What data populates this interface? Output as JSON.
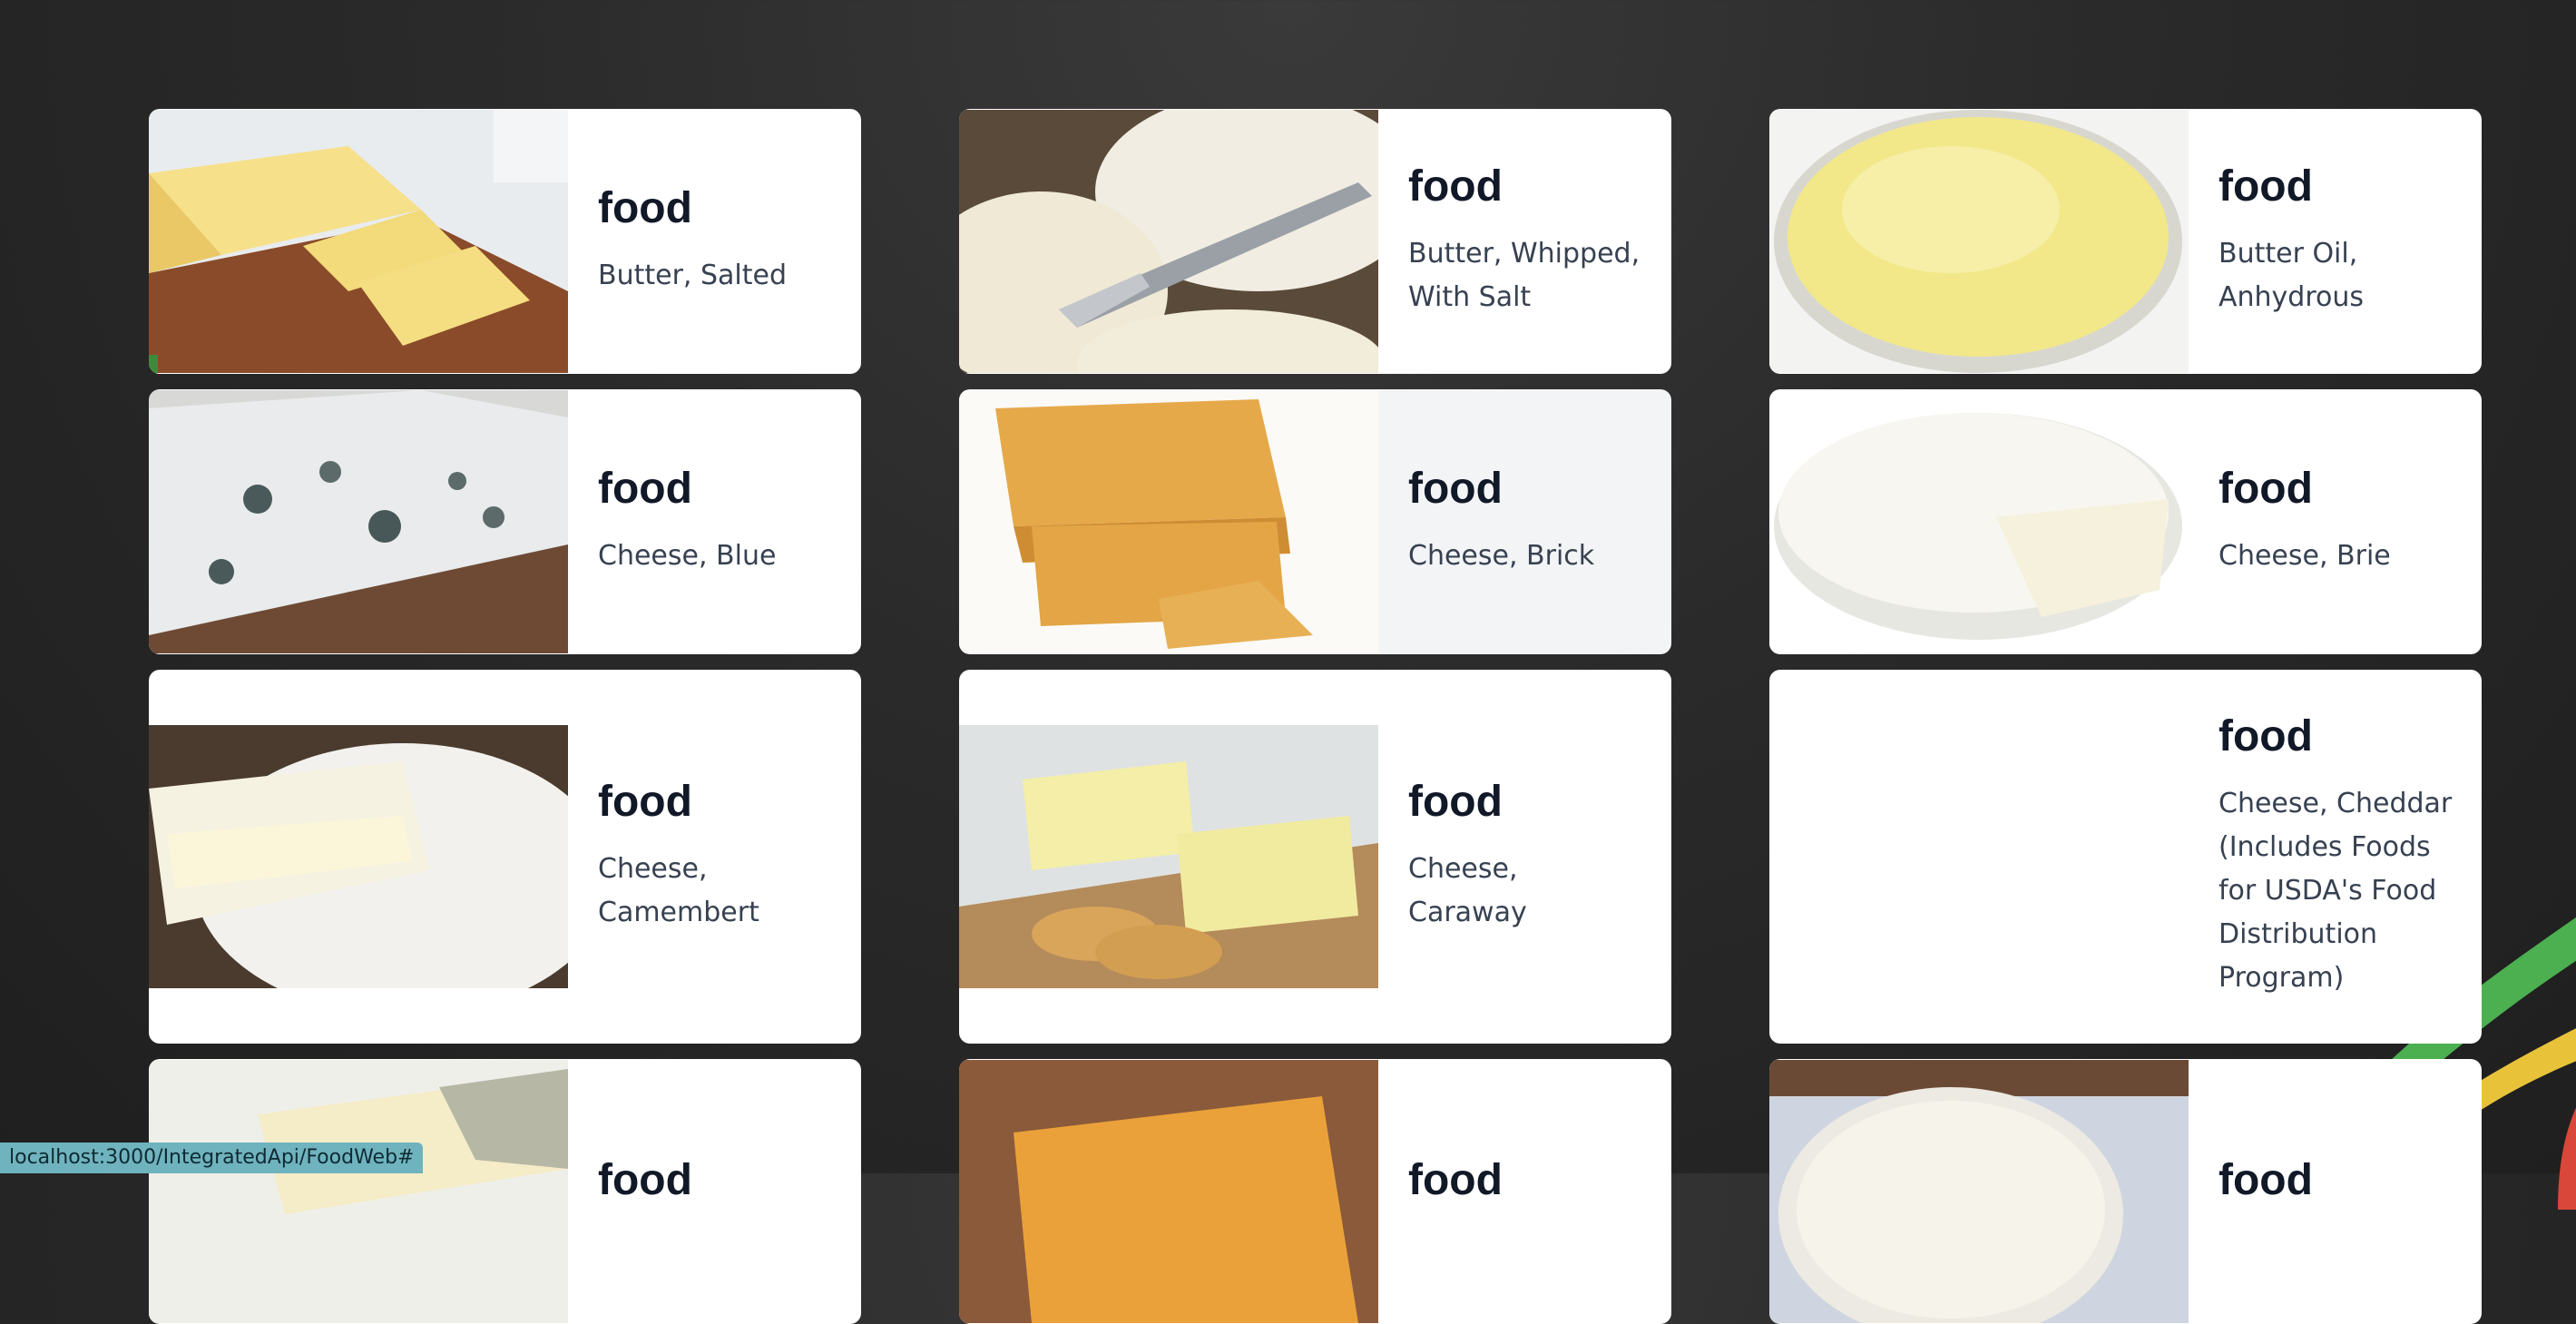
{
  "foods": [
    {
      "title": "food",
      "name": "Butter, Salted"
    },
    {
      "title": "food",
      "name": "Butter, Whipped, With Salt"
    },
    {
      "title": "food",
      "name": "Butter Oil, Anhydrous"
    },
    {
      "title": "food",
      "name": "Cheese, Blue"
    },
    {
      "title": "food",
      "name": "Cheese, Brick"
    },
    {
      "title": "food",
      "name": "Cheese, Brie"
    },
    {
      "title": "food",
      "name": "Cheese, Camembert"
    },
    {
      "title": "food",
      "name": "Cheese, Caraway"
    },
    {
      "title": "food",
      "name": "Cheese, Cheddar (Includes Foods for USDA's Food Distribution Program)"
    },
    {
      "title": "food",
      "name": ""
    },
    {
      "title": "food",
      "name": ""
    },
    {
      "title": "food",
      "name": ""
    }
  ],
  "status_bar": {
    "url": "localhost:3000/IntegratedApi/FoodWeb#"
  },
  "colors": {
    "card_bg": "#ffffff",
    "hover_bg": "#f3f4f6",
    "title": "#111827",
    "text": "#374151"
  }
}
